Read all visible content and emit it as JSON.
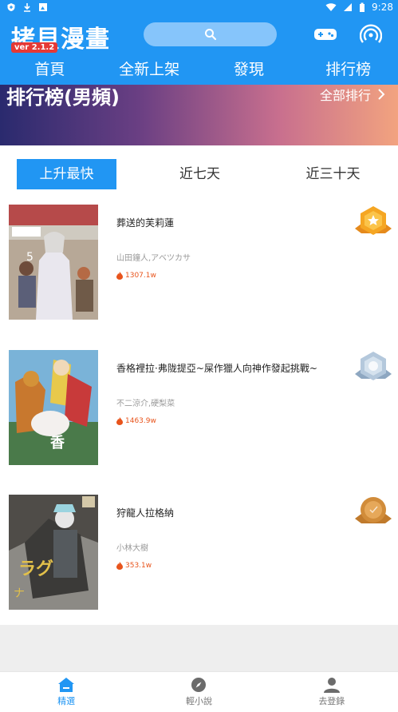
{
  "status_bar": {
    "time": "9:28",
    "left_icons": [
      "shield-icon",
      "download-icon",
      "image-icon"
    ],
    "right_icons": [
      "wifi-icon",
      "signal-icon",
      "battery-icon"
    ]
  },
  "header": {
    "app_title": "拷貝漫畫",
    "version": "ver 2.1.2",
    "search_icon": "search-icon",
    "game_icon": "gamepad-icon",
    "broadcast_icon": "broadcast-icon"
  },
  "nav_tabs": [
    "首頁",
    "全新上架",
    "發現",
    "排行榜"
  ],
  "banner": {
    "title": "排行榜(男頻)",
    "all_link": "全部排行"
  },
  "segments": [
    "上升最快",
    "近七天",
    "近三十天"
  ],
  "items": [
    {
      "title": "葬送的芙莉蓮",
      "author": "山田鐘人,アベツカサ",
      "heat": "1307.1w",
      "medal": "gold"
    },
    {
      "title": "香格裡拉·弗陇提亞~屎作獵人向神作發起挑戰~",
      "author": "不二涼介,硬梨菜",
      "heat": "1463.9w",
      "medal": "silver"
    },
    {
      "title": "狩龍人拉格納",
      "author": "小林大樹",
      "heat": "353.1w",
      "medal": "bronze"
    }
  ],
  "bottom_nav": [
    "精選",
    "輕小說",
    "去登錄"
  ],
  "colors": {
    "primary": "#2196f3",
    "heat": "#e8541c",
    "gold": "#f5a623",
    "silver": "#9fb7d0",
    "bronze": "#d18c3a"
  }
}
